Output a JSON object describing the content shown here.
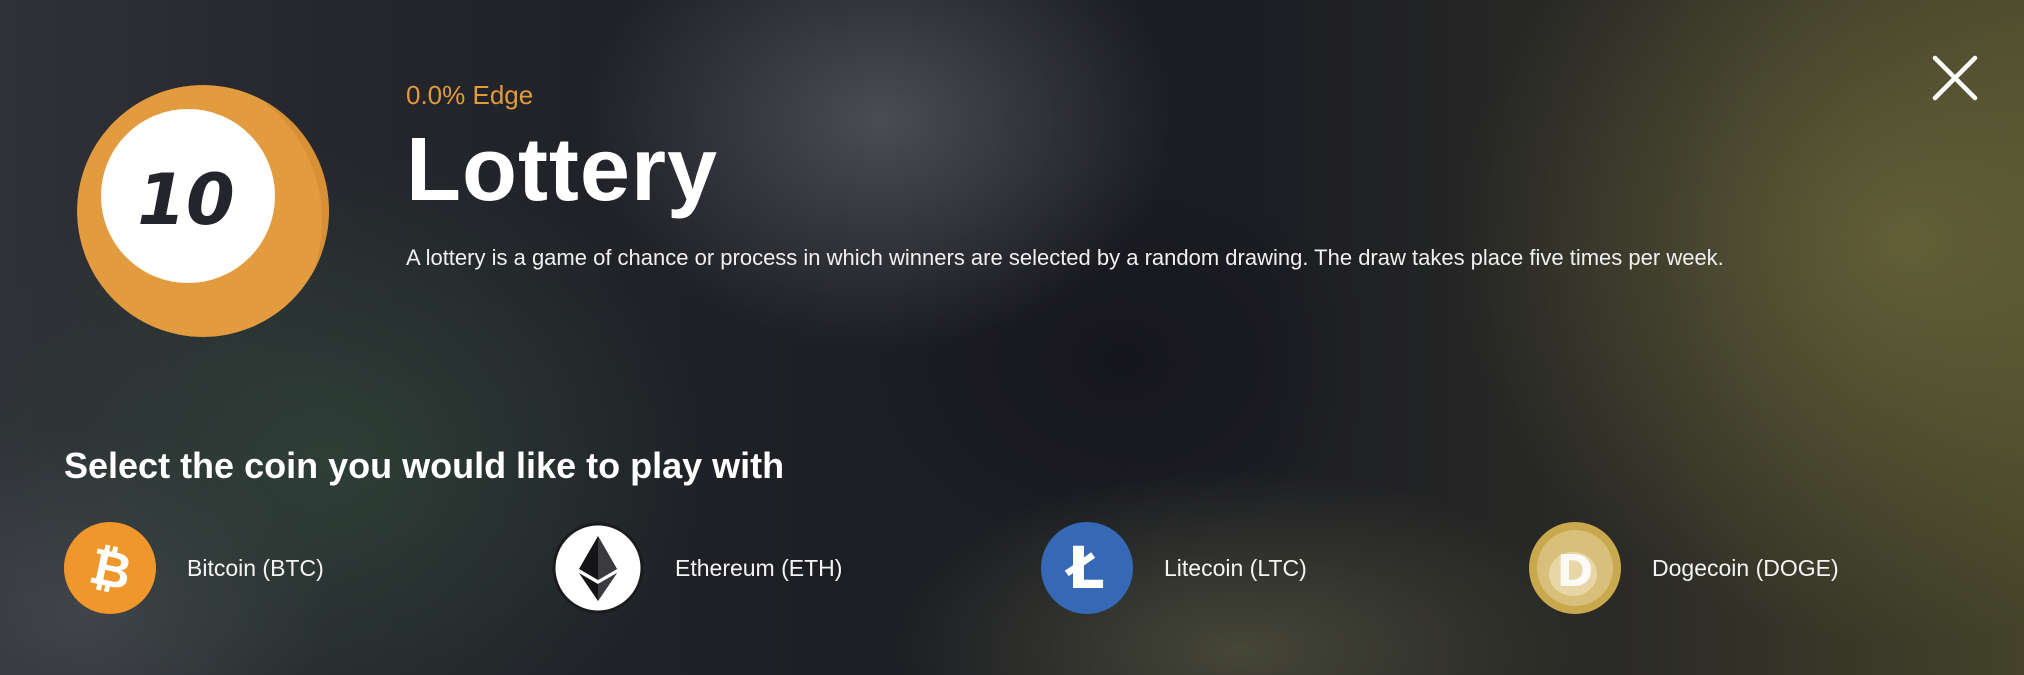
{
  "modal": {
    "close_icon": "close-icon"
  },
  "game": {
    "icon_name": "lottery-ball-icon",
    "icon_number": "10",
    "edge": "0.0% Edge",
    "title": "Lottery",
    "description": "A lottery is a game of chance or process in which winners are selected by a random drawing. The draw takes place five times per week."
  },
  "coin_selection": {
    "heading": "Select the coin you would like to play with",
    "coins": [
      {
        "label": "Bitcoin (BTC)",
        "icon": "bitcoin-icon",
        "color": "#f0972c"
      },
      {
        "label": "Ethereum (ETH)",
        "icon": "ethereum-icon",
        "color": "#ffffff"
      },
      {
        "label": "Litecoin (LTC)",
        "icon": "litecoin-icon",
        "color": "#3569b6"
      },
      {
        "label": "Dogecoin (DOGE)",
        "icon": "dogecoin-icon",
        "color": "#c8a94d"
      }
    ]
  },
  "colors": {
    "accent": "#e29a3a",
    "text": "#ffffff"
  }
}
